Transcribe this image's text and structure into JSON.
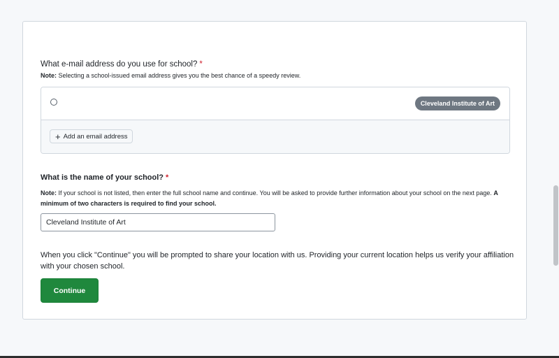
{
  "email_question": {
    "title": "What e-mail address do you use for school?",
    "required_mark": "*",
    "note_label": "Note:",
    "note_text": "Selecting a school-issued email address gives you the best chance of a speedy review.",
    "options": [
      {
        "school_badge": "Cleveland Institute of Art",
        "selected": false
      }
    ],
    "add_button_label": "Add an email address"
  },
  "school_question": {
    "title": "What is the name of your school?",
    "required_mark": "*",
    "note_label": "Note:",
    "note_text": "If your school is not listed, then enter the full school name and continue. You will be asked to provide further information about your school on the next page.",
    "note_bold_text": "A minimum of two characters is required to find your school.",
    "input_value": "Cleveland Institute of Art"
  },
  "location_note": "When you click \"Continue\" you will be prompted to share your location with us. Providing your current location helps us verify your affiliation with your chosen school.",
  "continue_label": "Continue",
  "colors": {
    "primary_button": "#1f883d",
    "required": "#cf222e",
    "badge": "#6e7781"
  }
}
